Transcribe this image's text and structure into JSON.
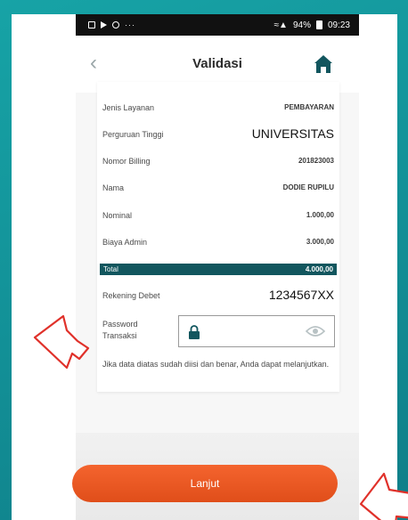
{
  "status_bar": {
    "left_dots": "···",
    "battery_text": "94%",
    "time": "09:23"
  },
  "header": {
    "title": "Validasi"
  },
  "details": [
    {
      "label": "Jenis Layanan",
      "value": "PEMBAYARAN"
    },
    {
      "label": "Perguruan Tinggi",
      "value": "UNIVERSITAS"
    },
    {
      "label": "Nomor Billing",
      "value": "201823003"
    },
    {
      "label": "Nama",
      "value": "DODIE RUPILU"
    },
    {
      "label": "Nominal",
      "value": "1.000,00"
    },
    {
      "label": "Biaya Admin",
      "value": "3.000,00"
    }
  ],
  "total": {
    "label": "Total",
    "value": "4.000,00"
  },
  "rekening": {
    "label": "Rekening Debet",
    "value": "1234567XX"
  },
  "password": {
    "label_line1": "Password",
    "label_line2": "Transaksi",
    "value": ""
  },
  "note": "Jika data diatas sudah diisi dan benar, Anda dapat melanjutkan.",
  "button": {
    "label": "Lanjut"
  },
  "colors": {
    "frame": "#17a3a6",
    "total_bar": "#12565e",
    "button": "#f4642e",
    "home_icon": "#12565e",
    "arrow": "#e0312a"
  }
}
